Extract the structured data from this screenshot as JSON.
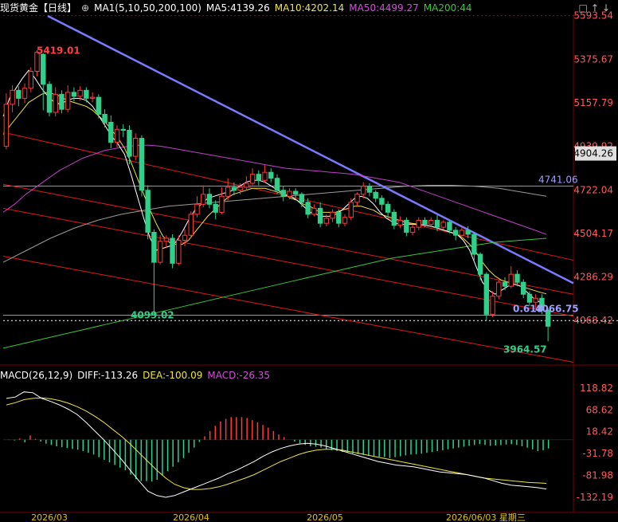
{
  "header": {
    "instrument": "现货黄金",
    "period_tag": "【日线】",
    "ma_group": "MA1(5,10,50,200,100)",
    "ma5": "MA5:4139.26",
    "ma10": "MA10:4202.14",
    "ma50": "MA50:4499.27",
    "ma200": "MA200:44",
    "controls": "□↑↓"
  },
  "macd_header": {
    "name": "MACD(26,12,9)",
    "diff": "DIFF:-113.26",
    "dea": "DEA:-100.09",
    "macd": "MACD:-26.35"
  },
  "colors": {
    "up": "#ff3a3a",
    "down": "#2fd08a",
    "ma5": "#ffffff",
    "ma10": "#f0e442",
    "ma50": "#c040c8",
    "ma200": "#38c838",
    "ma100": "#9a9a9a",
    "trendline": "#7a7aff",
    "channel": "#e01818",
    "price_axis_text": "#ff5a5a",
    "macd_axis_text": "#ff5a5a",
    "date_axis_text": "#e0c000"
  },
  "annotations": {
    "high_label": "5419.01",
    "low_label": "4099.02",
    "fib_label": "0.618",
    "fib_value": "4066.75",
    "recent_low": "3964.57",
    "hline_label": "4741.06",
    "ma_tag": "4904.26"
  },
  "chart_data": {
    "type": "candlestick",
    "price_axis_ticks": [
      "5593.54",
      "5375.67",
      "5157.79",
      "4939.92",
      "4722.04",
      "4504.17",
      "4286.29",
      "4068.42"
    ],
    "macd_axis_ticks": [
      "118.82",
      "68.62",
      "18.42",
      "-31.78",
      "-81.98",
      "-132.19"
    ],
    "date_labels": [
      "2026/03",
      "2026/04",
      "2026/05",
      "2026/06/03 星期三"
    ],
    "ylim": [
      3870,
      5600
    ],
    "macd_ylim": [
      -165,
      135
    ],
    "candles": [
      [
        4940,
        5150,
        5205,
        4925
      ],
      [
        5150,
        5220,
        5245,
        5110
      ],
      [
        5220,
        5180,
        5240,
        5140
      ],
      [
        5180,
        5230,
        5255,
        5155
      ],
      [
        5230,
        5315,
        5335,
        5210
      ],
      [
        5315,
        5410,
        5420,
        5290
      ],
      [
        5400,
        5250,
        5405,
        5120
      ],
      [
        5250,
        5110,
        5265,
        5090
      ],
      [
        5110,
        5200,
        5235,
        5090
      ],
      [
        5200,
        5125,
        5220,
        5105
      ],
      [
        5125,
        5210,
        5245,
        5110
      ],
      [
        5210,
        5190,
        5235,
        5165
      ],
      [
        5190,
        5220,
        5240,
        5170
      ],
      [
        5220,
        5180,
        5235,
        5160
      ],
      [
        5180,
        5185,
        5210,
        5160
      ],
      [
        5185,
        5100,
        5200,
        5080
      ],
      [
        5100,
        5060,
        5125,
        5035
      ],
      [
        5060,
        4960,
        5095,
        4930
      ],
      [
        4960,
        5025,
        5045,
        4935
      ],
      [
        5025,
        5020,
        5050,
        4985
      ],
      [
        5020,
        4890,
        5045,
        4850
      ],
      [
        4890,
        4980,
        5005,
        4870
      ],
      [
        4980,
        4720,
        4995,
        4690
      ],
      [
        4720,
        4510,
        4745,
        4475
      ],
      [
        4510,
        4360,
        4525,
        4100
      ],
      [
        4360,
        4465,
        4495,
        4350
      ],
      [
        4465,
        4480,
        4495,
        4430
      ],
      [
        4480,
        4355,
        4500,
        4330
      ],
      [
        4355,
        4470,
        4495,
        4345
      ],
      [
        4470,
        4495,
        4525,
        4440
      ],
      [
        4495,
        4600,
        4615,
        4480
      ],
      [
        4600,
        4650,
        4690,
        4585
      ],
      [
        4650,
        4700,
        4745,
        4635
      ],
      [
        4700,
        4650,
        4730,
        4630
      ],
      [
        4650,
        4610,
        4670,
        4575
      ],
      [
        4610,
        4690,
        4735,
        4600
      ],
      [
        4690,
        4735,
        4780,
        4670
      ],
      [
        4735,
        4720,
        4760,
        4695
      ],
      [
        4720,
        4735,
        4755,
        4700
      ],
      [
        4735,
        4755,
        4790,
        4720
      ],
      [
        4755,
        4800,
        4830,
        4745
      ],
      [
        4800,
        4770,
        4820,
        4745
      ],
      [
        4770,
        4810,
        4845,
        4760
      ],
      [
        4810,
        4780,
        4830,
        4760
      ],
      [
        4780,
        4720,
        4800,
        4700
      ],
      [
        4720,
        4690,
        4740,
        4665
      ],
      [
        4690,
        4715,
        4730,
        4675
      ],
      [
        4715,
        4700,
        4730,
        4680
      ],
      [
        4700,
        4660,
        4710,
        4635
      ],
      [
        4660,
        4600,
        4680,
        4580
      ],
      [
        4600,
        4630,
        4650,
        4590
      ],
      [
        4630,
        4555,
        4660,
        4535
      ],
      [
        4555,
        4580,
        4600,
        4540
      ],
      [
        4580,
        4610,
        4625,
        4560
      ],
      [
        4610,
        4555,
        4625,
        4535
      ],
      [
        4555,
        4585,
        4600,
        4540
      ],
      [
        4585,
        4660,
        4680,
        4570
      ],
      [
        4660,
        4700,
        4710,
        4640
      ],
      [
        4700,
        4740,
        4760,
        4680
      ],
      [
        4740,
        4710,
        4755,
        4690
      ],
      [
        4710,
        4680,
        4720,
        4660
      ],
      [
        4680,
        4650,
        4695,
        4620
      ],
      [
        4650,
        4610,
        4665,
        4580
      ],
      [
        4610,
        4545,
        4625,
        4525
      ],
      [
        4545,
        4570,
        4590,
        4530
      ],
      [
        4570,
        4510,
        4585,
        4490
      ],
      [
        4510,
        4535,
        4550,
        4495
      ],
      [
        4535,
        4570,
        4585,
        4520
      ],
      [
        4570,
        4550,
        4585,
        4535
      ],
      [
        4550,
        4570,
        4585,
        4535
      ],
      [
        4570,
        4535,
        4595,
        4515
      ],
      [
        4535,
        4560,
        4570,
        4525
      ],
      [
        4560,
        4520,
        4570,
        4505
      ],
      [
        4520,
        4495,
        4535,
        4470
      ],
      [
        4495,
        4520,
        4540,
        4480
      ],
      [
        4520,
        4500,
        4540,
        4480
      ],
      [
        4500,
        4400,
        4510,
        4370
      ],
      [
        4400,
        4300,
        4410,
        4270
      ],
      [
        4300,
        4100,
        4310,
        4070
      ],
      [
        4100,
        4190,
        4215,
        4085
      ],
      [
        4190,
        4260,
        4270,
        4175
      ],
      [
        4260,
        4240,
        4285,
        4220
      ],
      [
        4240,
        4300,
        4340,
        4230
      ],
      [
        4300,
        4260,
        4320,
        4240
      ],
      [
        4260,
        4200,
        4275,
        4180
      ],
      [
        4200,
        4160,
        4215,
        4140
      ],
      [
        4160,
        4180,
        4200,
        4130
      ],
      [
        4180,
        4120,
        4200,
        4100
      ],
      [
        4120,
        4040,
        4130,
        3964.57
      ]
    ],
    "macd_hist": [
      -0.5,
      -1.5,
      3,
      -6,
      10,
      2,
      -4,
      -9,
      -12,
      -15,
      -17,
      -19,
      -21,
      -23,
      -26,
      -30,
      -34,
      -40,
      -46,
      -52,
      -58,
      -64,
      -70,
      -80,
      -90,
      -95,
      -95,
      -96,
      -92,
      -82,
      -72,
      -62,
      -52,
      -42,
      -30,
      -18,
      -5,
      8,
      20,
      32,
      42,
      48,
      52,
      52,
      52,
      50,
      45,
      40,
      34,
      28,
      20,
      12,
      6,
      0,
      -4,
      -8,
      -12,
      -15,
      -16,
      -18,
      -22,
      -24,
      -26,
      -28,
      -30,
      -31,
      -33,
      -35,
      -37,
      -38,
      -39,
      -40,
      -42,
      -40,
      -38,
      -36,
      -34,
      -33,
      -32,
      -30,
      -28,
      -26,
      -24,
      -22,
      -20,
      -18,
      -16,
      -14,
      -12,
      -10,
      -12,
      -14,
      -13,
      -12,
      -11,
      -10,
      -12,
      -15,
      -18,
      -22,
      -26,
      -24,
      -20
    ],
    "series": [
      {
        "name": "MA5",
        "values": [
          5090,
          5180,
          5230,
          5280,
          5320,
          5280,
          5230,
          5190,
          5160,
          5150,
          5170,
          5180,
          5180,
          5170,
          5140,
          5090,
          5040,
          4990,
          4950,
          4900,
          4800,
          4690,
          4580,
          4480,
          4420,
          4430,
          4440,
          4460,
          4510,
          4570,
          4620,
          4650,
          4680,
          4690,
          4700,
          4710,
          4720,
          4740,
          4760,
          4770,
          4770,
          4760,
          4740,
          4720,
          4700,
          4690,
          4670,
          4640,
          4610,
          4600,
          4590,
          4590,
          4600,
          4620,
          4650,
          4680,
          4690,
          4680,
          4650,
          4610,
          4580,
          4560,
          4550,
          4550,
          4550,
          4550,
          4545,
          4540,
          4530,
          4520,
          4510,
          4500,
          4470,
          4420,
          4340,
          4260,
          4220,
          4200,
          4220,
          4240,
          4250,
          4240,
          4210,
          4180,
          4160,
          4139
        ]
      },
      {
        "name": "MA10",
        "values": [
          5000,
          5040,
          5080,
          5120,
          5160,
          5180,
          5200,
          5210,
          5200,
          5190,
          5170,
          5160,
          5150,
          5140,
          5120,
          5090,
          5060,
          5020,
          4980,
          4930,
          4860,
          4780,
          4700,
          4620,
          4550,
          4490,
          4460,
          4450,
          4450,
          4470,
          4510,
          4550,
          4590,
          4620,
          4650,
          4680,
          4700,
          4710,
          4720,
          4730,
          4730,
          4730,
          4720,
          4710,
          4700,
          4680,
          4670,
          4650,
          4640,
          4620,
          4610,
          4610,
          4610,
          4620,
          4630,
          4640,
          4640,
          4630,
          4620,
          4600,
          4590,
          4580,
          4570,
          4560,
          4555,
          4550,
          4545,
          4540,
          4530,
          4520,
          4510,
          4500,
          4480,
          4450,
          4410,
          4360,
          4320,
          4290,
          4270,
          4260,
          4250,
          4240,
          4230,
          4220,
          4210,
          4202
        ]
      },
      {
        "name": "MA50",
        "values": [
          4610,
          4650,
          4700,
          4740,
          4780,
          4820,
          4850,
          4880,
          4900,
          4920,
          4930,
          4940,
          4945,
          4945,
          4940,
          4930,
          4920,
          4910,
          4900,
          4890,
          4880,
          4870,
          4860,
          4850,
          4840,
          4830,
          4825,
          4820,
          4815,
          4810,
          4805,
          4800,
          4790,
          4780,
          4770,
          4760,
          4740,
          4720,
          4700,
          4680,
          4660,
          4640,
          4620,
          4600,
          4580,
          4560,
          4540,
          4520,
          4499
        ]
      },
      {
        "name": "MA200",
        "values": [
          3930,
          3960,
          3990,
          4020,
          4050,
          4080,
          4110,
          4140,
          4170,
          4200,
          4230,
          4260,
          4290,
          4320,
          4350,
          4380,
          4400,
          4420,
          4440,
          4460,
          4470,
          4480
        ]
      },
      {
        "name": "MA100",
        "values": [
          4360,
          4420,
          4480,
          4530,
          4570,
          4600,
          4620,
          4640,
          4650,
          4660,
          4670,
          4680,
          4690,
          4700,
          4710,
          4720,
          4730,
          4740,
          4745,
          4745,
          4740,
          4730,
          4710,
          4690
        ]
      },
      {
        "name": "DIFF",
        "values": [
          95,
          98,
          110,
          108,
          95,
          88,
          80,
          70,
          58,
          40,
          20,
          0,
          -22,
          -45,
          -70,
          -95,
          -118,
          -128,
          -132,
          -128,
          -120,
          -112,
          -104,
          -96,
          -88,
          -78,
          -70,
          -60,
          -50,
          -38,
          -28,
          -20,
          -14,
          -10,
          -8,
          -10,
          -14,
          -20,
          -26,
          -32,
          -38,
          -44,
          -50,
          -54,
          -58,
          -60,
          -62,
          -66,
          -70,
          -74,
          -76,
          -78,
          -80,
          -84,
          -88,
          -94,
          -100,
          -104,
          -106,
          -108,
          -110,
          -113
        ]
      },
      {
        "name": "DEA",
        "values": [
          80,
          85,
          92,
          95,
          96,
          94,
          90,
          84,
          76,
          66,
          54,
          40,
          24,
          8,
          -10,
          -30,
          -50,
          -70,
          -88,
          -102,
          -110,
          -114,
          -114,
          -112,
          -108,
          -102,
          -95,
          -88,
          -80,
          -70,
          -60,
          -50,
          -42,
          -34,
          -28,
          -24,
          -22,
          -22,
          -24,
          -28,
          -32,
          -36,
          -40,
          -44,
          -48,
          -52,
          -56,
          -60,
          -64,
          -68,
          -72,
          -76,
          -80,
          -84,
          -88,
          -90,
          -92,
          -94,
          -96,
          -98,
          -99,
          -100
        ]
      }
    ]
  }
}
